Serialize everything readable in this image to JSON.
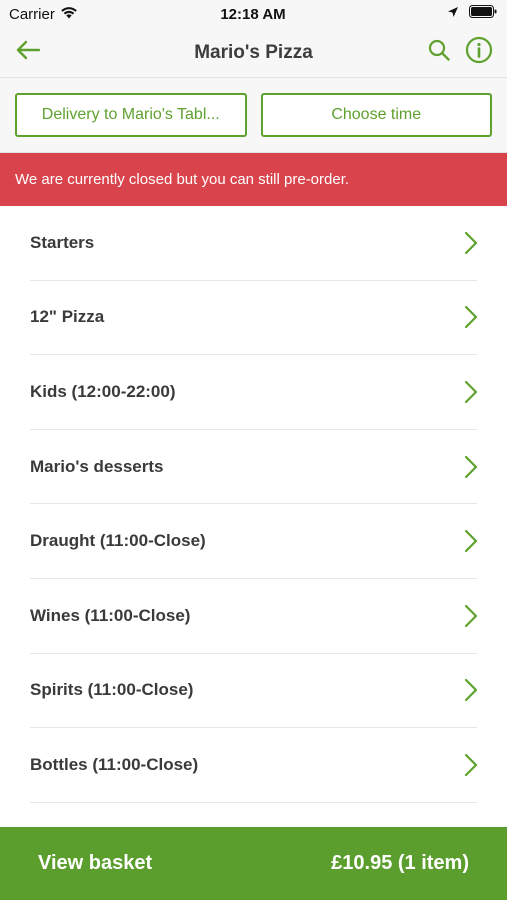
{
  "status_bar": {
    "carrier": "Carrier",
    "time": "12:18 AM"
  },
  "nav": {
    "title": "Mario's Pizza",
    "back_icon": "arrow-left-icon",
    "search_icon": "search-icon",
    "info_icon": "info-icon"
  },
  "order_options": {
    "delivery_label": "Delivery to Mario's Tabl...",
    "time_label": "Choose time"
  },
  "banner": {
    "text": "We are currently closed but you can still pre-order."
  },
  "menu": {
    "items": [
      {
        "label": "Starters"
      },
      {
        "label": "12\" Pizza"
      },
      {
        "label": "Kids (12:00-22:00)"
      },
      {
        "label": "Mario's desserts"
      },
      {
        "label": "Draught (11:00-Close)"
      },
      {
        "label": "Wines (11:00-Close)"
      },
      {
        "label": "Spirits (11:00-Close)"
      },
      {
        "label": "Bottles (11:00-Close)"
      }
    ]
  },
  "basket": {
    "label": "View basket",
    "total": "£10.95 (1 item)"
  },
  "colors": {
    "accent": "#5fa12e",
    "banner": "#d9444c",
    "basket_bar": "#5c9e2d"
  }
}
